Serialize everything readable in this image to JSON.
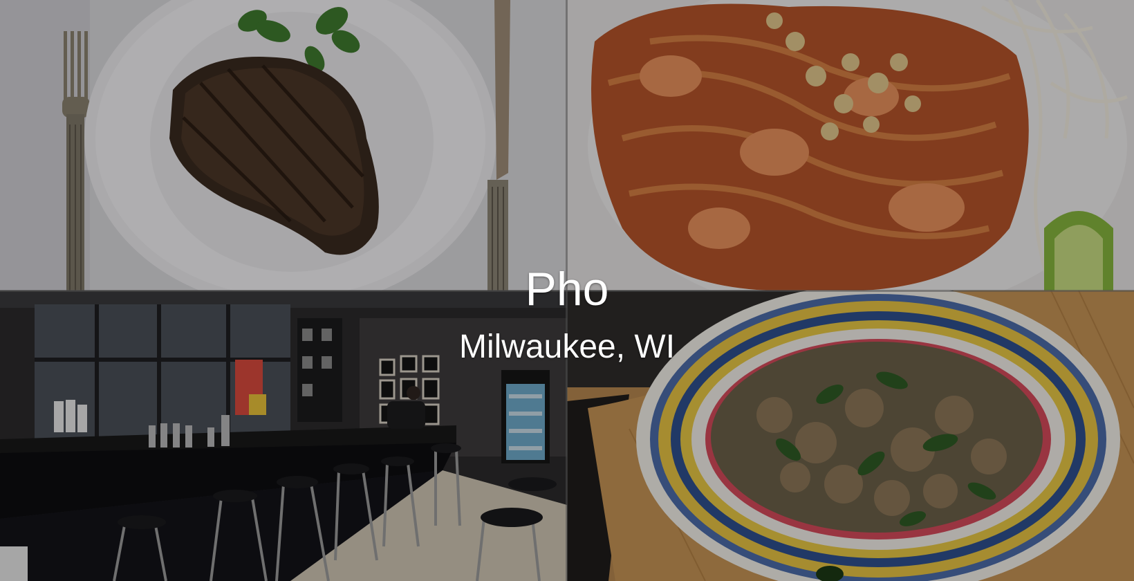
{
  "hero": {
    "title": "Pho",
    "subtitle": "Milwaukee, WI"
  },
  "tiles": [
    {
      "subject": "ribeye-steak-on-plate"
    },
    {
      "subject": "pad-thai-shrimp-peanuts"
    },
    {
      "subject": "restaurant-bar-interior"
    },
    {
      "subject": "larb-salad-on-patterned-plate"
    }
  ]
}
